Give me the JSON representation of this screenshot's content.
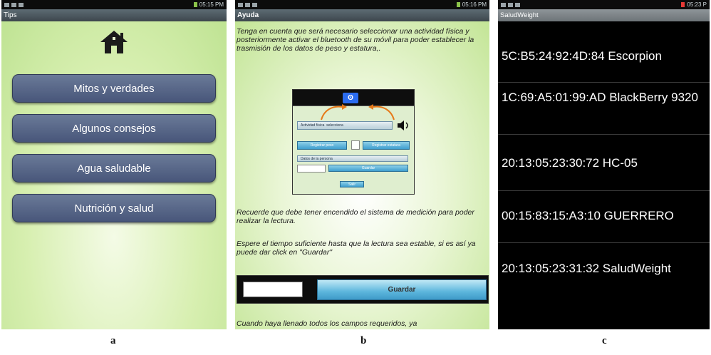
{
  "panels": {
    "a": {
      "status_time": "05:15 PM",
      "title": "Tips",
      "home_icon": "home-icon",
      "buttons": [
        "Mitos y verdades",
        "Algunos consejos",
        "Agua saludable",
        "Nutrición y salud"
      ],
      "caption": "a"
    },
    "b": {
      "status_time": "05:16 PM",
      "title": "Ayuda",
      "paragraphs": [
        "Tenga en cuenta que será necesario seleccionar una actividad física  y posteriormente activar el bluetooth de su móvil para poder establecer la trasmisión de los datos de peso y estatura,.",
        "Recuerde que debe tener encendido el sistema de medición para poder  realizar la lectura.",
        "Espere el tiempo suficiente  hasta que la lectura sea estable, si es así ya puede dar click en \"Guardar\"",
        "Cuando haya llenado todos los campos requeridos, ya"
      ],
      "mini": {
        "bt_label": "ʘ",
        "activity_label": "Actividad física",
        "activity_value": "selecciona",
        "btn_left": "Registrar peso",
        "btn_right": "Registrar estatura",
        "info_text": "Datos de la persona",
        "save_label": "Guardar",
        "exit_label": "Salir"
      },
      "save_label": "Guardar",
      "caption": "b"
    },
    "c": {
      "status_time": "05:23 P",
      "title": "SaludWeight",
      "devices": [
        "5C:B5:24:92:4D:84 Escorpion",
        "1C:69:A5:01:99:AD BlackBerry 9320",
        "20:13:05:23:30:72 HC-05",
        "00:15:83:15:A3:10 GUERRERO",
        "20:13:05:23:31:32 SaludWeight"
      ],
      "caption": "c"
    }
  },
  "colors": {
    "green_bg": "#d7efb0",
    "button_blue": "#56648a",
    "titlebar": "#4a555c",
    "list_bg": "#000000",
    "accent_blue": "#3f9fcf"
  }
}
